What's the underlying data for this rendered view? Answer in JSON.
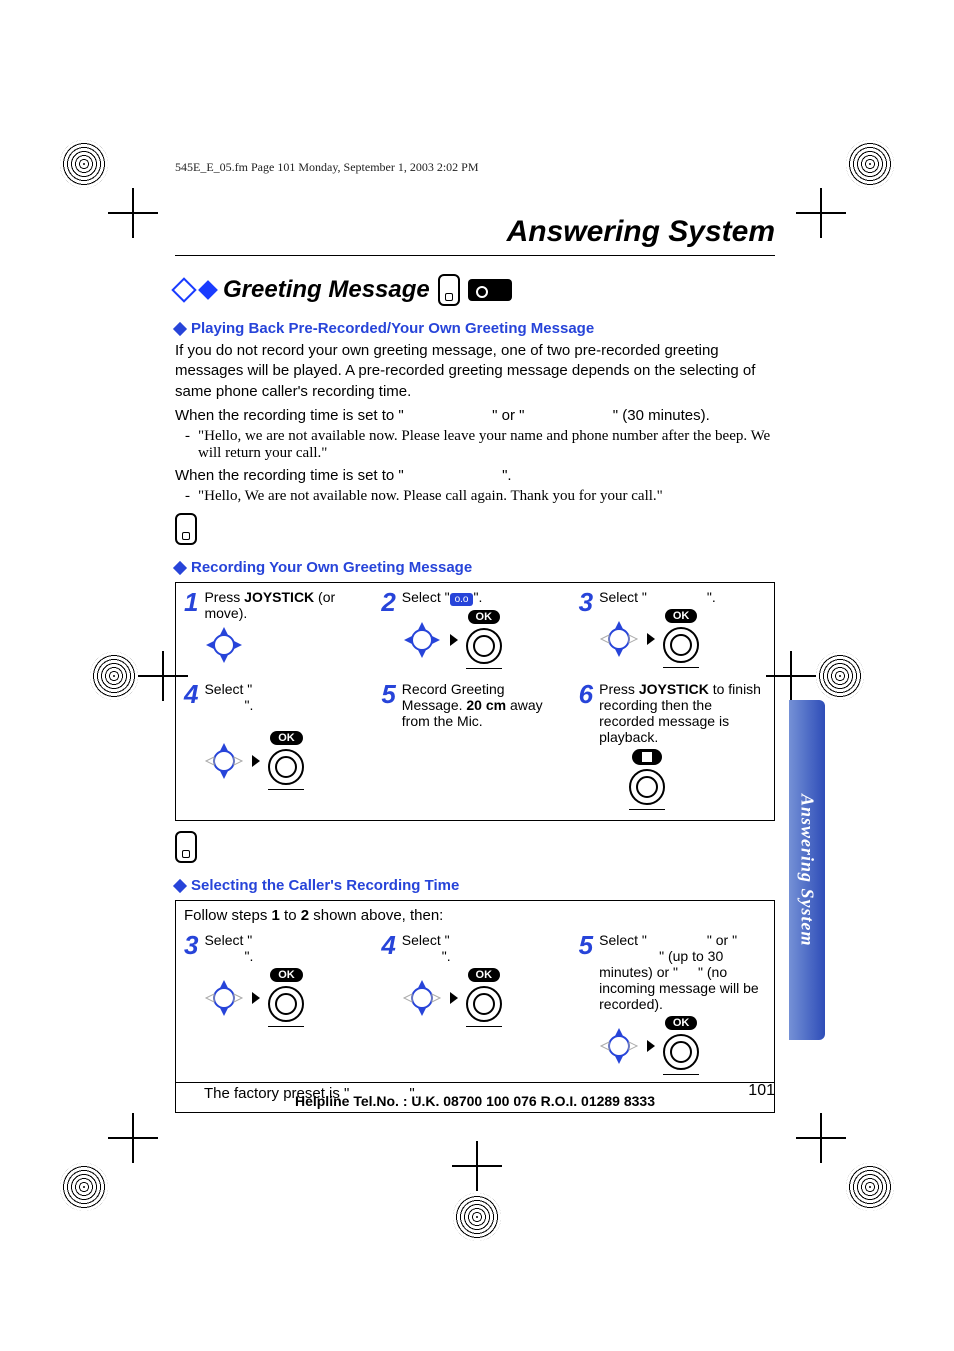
{
  "page_header": "545E_E_05.fm  Page 101  Monday, September 1, 2003  2:02 PM",
  "chapter_title": "Answering System",
  "section_title": "Greeting Message",
  "subsections": {
    "playback": {
      "title": "Playing Back Pre-Recorded/Your Own Greeting Message",
      "body": "If you do not record your own greeting message, one of two pre-recorded greeting messages will be played. A pre-recorded greeting message depends on the selecting of same phone caller's recording time.",
      "line1_a": "When the recording time is set to \"",
      "line1_b": "\" or \"",
      "line1_c": "\" (30 minutes).",
      "msg1": "\"Hello, we are not available now. Please leave your name and phone number after the beep. We will return your call.\"",
      "line2_a": "When the recording time is set to \"",
      "line2_b": "\".",
      "msg2": "\"Hello, We are not available now. Please call again. Thank you for your call.\""
    },
    "record": {
      "title": "Recording Your Own Greeting Message"
    },
    "rectime": {
      "title": "Selecting the Caller's Recording Time",
      "intro_a": "Follow steps ",
      "intro_b": "1",
      "intro_c": " to ",
      "intro_d": "2",
      "intro_e": " shown above, then:",
      "preset_a": "The factory preset is \"",
      "preset_b": "\"."
    }
  },
  "steps_record": {
    "s1": {
      "num": "1",
      "text_a": "Press ",
      "text_b": "JOYSTICK",
      "text_c": " (or move)."
    },
    "s2": {
      "num": "2",
      "text_a": "Select \"",
      "text_b": "\"."
    },
    "s3": {
      "num": "3",
      "text_a": "Select \"",
      "text_b": "\"."
    },
    "s4": {
      "num": "4",
      "text_a": "Select \"",
      "text_b": "\"."
    },
    "s5": {
      "num": "5",
      "text_a": "Record Greeting Message. ",
      "text_b": "20 cm",
      "text_c": " away from the Mic."
    },
    "s6": {
      "num": "6",
      "text_a": "Press ",
      "text_b": "JOYSTICK",
      "text_c": "  to finish recording then the recorded message is playback."
    }
  },
  "steps_rectime": {
    "s3": {
      "num": "3",
      "text_a": "Select \"",
      "text_b": "\"."
    },
    "s4": {
      "num": "4",
      "text_a": "Select \"",
      "text_b": "\"."
    },
    "s5": {
      "num": "5",
      "text_a": "Select \"",
      "text_b": "\" or \"",
      "text_c": "\" (up to 30 minutes) or \"",
      "text_d": "\"  (no incoming message will be recorded)."
    }
  },
  "labels": {
    "ok": "OK",
    "side_tab": "Answering System",
    "helpline": "Helpline Tel.No. : U.K. 08700 100 076  R.O.I. 01289 8333",
    "page_num": "101",
    "tape_badge": "o.o"
  }
}
